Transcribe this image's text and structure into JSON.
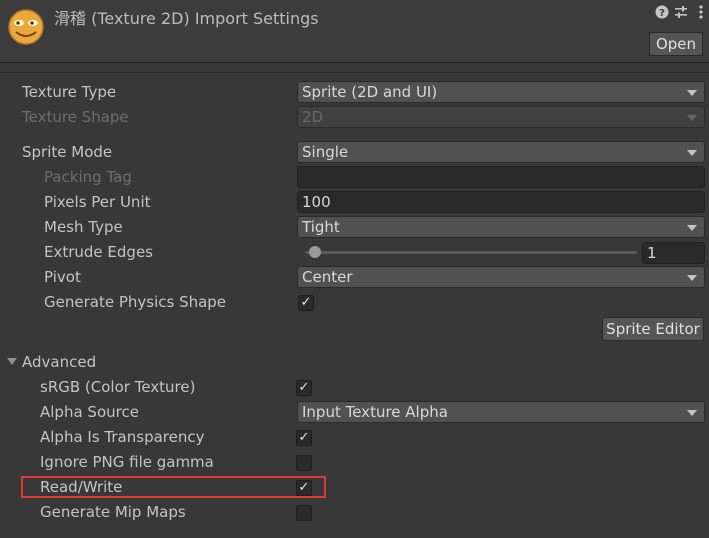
{
  "header": {
    "title": "滑稽 (Texture 2D) Import Settings",
    "open_label": "Open",
    "icons": [
      "help-icon",
      "preset-icon",
      "more-menu-icon"
    ]
  },
  "fields": {
    "texture_type": {
      "label": "Texture Type",
      "value": "Sprite (2D and UI)"
    },
    "texture_shape": {
      "label": "Texture Shape",
      "value": "2D"
    },
    "sprite_mode": {
      "label": "Sprite Mode",
      "value": "Single"
    },
    "packing_tag": {
      "label": "Packing Tag",
      "value": ""
    },
    "pixels_per_unit": {
      "label": "Pixels Per Unit",
      "value": "100"
    },
    "mesh_type": {
      "label": "Mesh Type",
      "value": "Tight"
    },
    "extrude_edges": {
      "label": "Extrude Edges",
      "value": "1",
      "slider_fraction": 0.0
    },
    "pivot": {
      "label": "Pivot",
      "value": "Center"
    },
    "generate_physics_shape": {
      "label": "Generate Physics Shape",
      "checked": true
    }
  },
  "sprite_editor_label": "Sprite Editor",
  "advanced": {
    "label": "Advanced",
    "srgb": {
      "label": "sRGB (Color Texture)",
      "checked": true
    },
    "alpha_source": {
      "label": "Alpha Source",
      "value": "Input Texture Alpha"
    },
    "alpha_is_transparency": {
      "label": "Alpha Is Transparency",
      "checked": true
    },
    "ignore_png_gamma": {
      "label": "Ignore PNG file gamma",
      "checked": false
    },
    "read_write": {
      "label": "Read/Write",
      "checked": true
    },
    "generate_mip_maps": {
      "label": "Generate Mip Maps",
      "checked": false
    }
  },
  "colors": {
    "background": "#383838",
    "highlight": "#e0393a"
  },
  "check_glyph": "✓"
}
